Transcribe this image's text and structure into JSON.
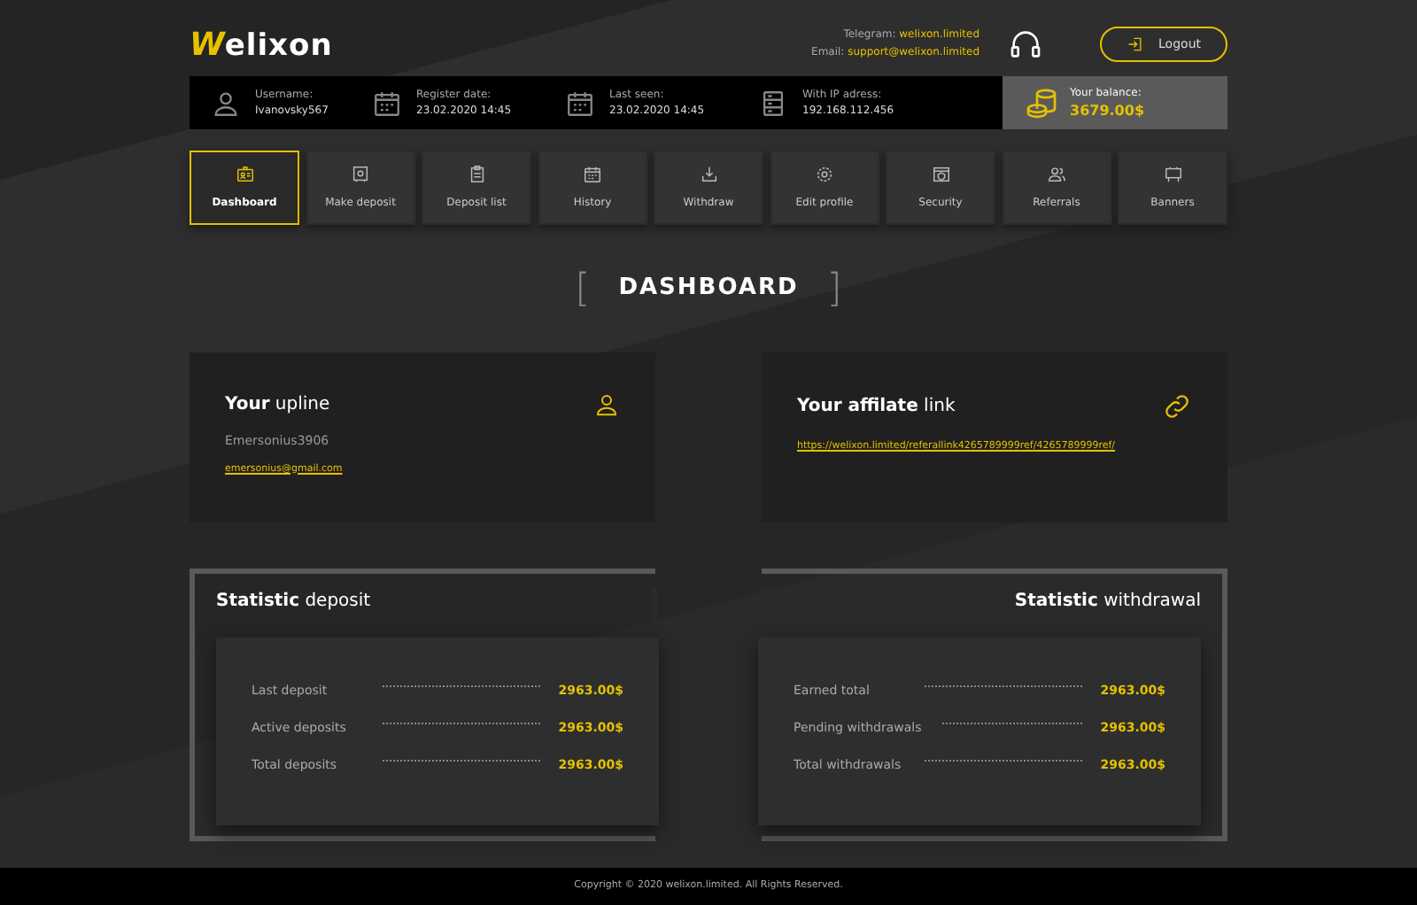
{
  "header": {
    "logo": {
      "initial": "W",
      "text": "elixon"
    },
    "contacts": [
      {
        "label": "Telegram:",
        "value": "welixon.limited"
      },
      {
        "label": "Email:",
        "value": "support@welixon.limited"
      }
    ],
    "logout": "Logout"
  },
  "info_bar": [
    {
      "kind": "user",
      "label": "Username:",
      "value": "Ivanovsky567"
    },
    {
      "kind": "calendar",
      "label": "Register date:",
      "value": "23.02.2020  14:45"
    },
    {
      "kind": "calendar",
      "label": "Last seen:",
      "value": "23.02.2020  14:45"
    },
    {
      "kind": "server",
      "label": "With IP adress:",
      "value": "192.168.112.456"
    }
  ],
  "balance": {
    "label": "Your balance:",
    "value": "3679.00$"
  },
  "nav": [
    {
      "label": "Dashboard",
      "selected": true
    },
    {
      "label": "Make deposit",
      "selected": false
    },
    {
      "label": "Deposit list",
      "selected": false
    },
    {
      "label": "History",
      "selected": false
    },
    {
      "label": "Withdraw",
      "selected": false
    },
    {
      "label": "Edit profile",
      "selected": false
    },
    {
      "label": "Security",
      "selected": false
    },
    {
      "label": "Referrals",
      "selected": false
    },
    {
      "label": "Banners",
      "selected": false
    }
  ],
  "page_title": {
    "open": "[",
    "text": "DASHBOARD",
    "close": "]"
  },
  "upline": {
    "title": "**Your** upline",
    "name": "Emersonius3906",
    "email": "emersonius@gmail.com"
  },
  "affiliate": {
    "title": "**Your affilate** link",
    "link": "https://welixon.limited/referallink4265789999ref/4265789999ref/"
  },
  "stats": [
    {
      "title": "**Statistic** deposit",
      "rows": [
        {
          "label": "Last deposit",
          "value": "2963.00$"
        },
        {
          "label": "Active deposits",
          "value": "2963.00$"
        },
        {
          "label": "Total deposits",
          "value": "2963.00$"
        }
      ]
    },
    {
      "title": "**Statistic** withdrawal",
      "rows": [
        {
          "label": "Earned total",
          "value": "2963.00$"
        },
        {
          "label": "Pending withdrawals",
          "value": "2963.00$"
        },
        {
          "label": "Total withdrawals",
          "value": "2963.00$"
        }
      ]
    }
  ],
  "footer": "Copyright © 2020 welixon.limited. All Rights Reserved."
}
